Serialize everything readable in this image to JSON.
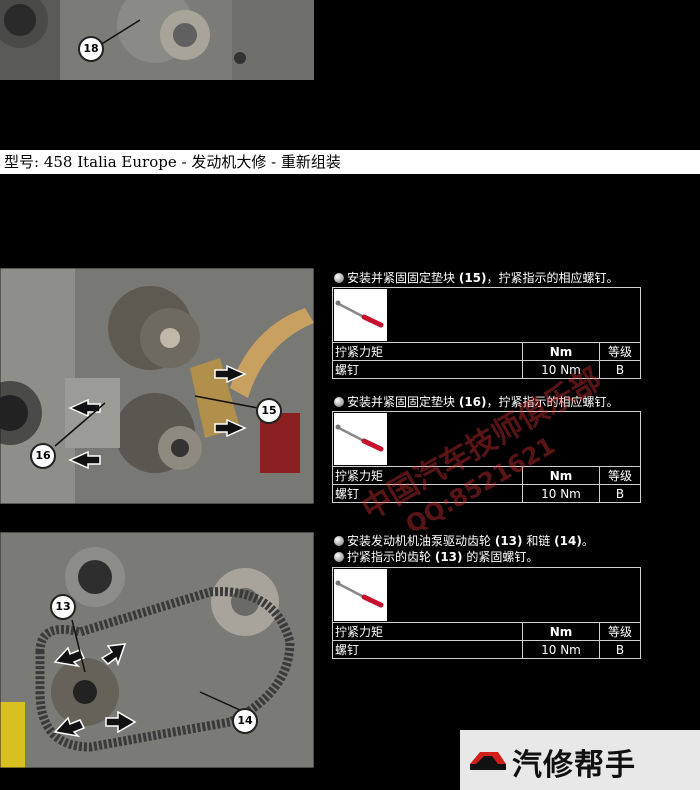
{
  "header": {
    "title": "型号: 458 Italia Europe - 发动机大修  - 重新组装"
  },
  "photos": {
    "top": {
      "callouts": [
        "18"
      ]
    },
    "mid": {
      "callouts": [
        "15",
        "16"
      ]
    },
    "bot": {
      "callouts": [
        "13",
        "14"
      ]
    }
  },
  "sections": [
    {
      "steps": [
        {
          "pre": "安装并紧固固定垫块 ",
          "ref": "(15)",
          "post": "，拧紧指示的相应螺钉。"
        }
      ],
      "torque": {
        "headers": [
          "拧紧力矩",
          "Nm",
          "等级"
        ],
        "rows": [
          [
            "螺钉",
            "10 Nm",
            "B"
          ]
        ]
      }
    },
    {
      "steps": [
        {
          "pre": "安装并紧固固定垫块 ",
          "ref": "(16)",
          "post": "，拧紧指示的相应螺钉。"
        }
      ],
      "torque": {
        "headers": [
          "拧紧力矩",
          "Nm",
          "等级"
        ],
        "rows": [
          [
            "螺钉",
            "10 Nm",
            "B"
          ]
        ]
      }
    },
    {
      "steps": [
        {
          "pre": "安装发动机机油泵驱动齿轮 ",
          "ref": "(13)",
          "mid": " 和链 ",
          "ref2": "(14)",
          "post": "。"
        },
        {
          "pre": "拧紧指示的齿轮 ",
          "ref": "(13)",
          "post": " 的紧固螺钉。"
        }
      ],
      "torque": {
        "headers": [
          "拧紧力矩",
          "Nm",
          "等级"
        ],
        "rows": [
          [
            "螺钉",
            "10 Nm",
            "B"
          ]
        ]
      }
    }
  ],
  "watermark": {
    "line1": "中国汽车技师俱乐部",
    "line2": "QQ:8521621"
  },
  "brand": {
    "name": "汽修帮手",
    "icon": "car-logo-icon",
    "color": "#d0201a"
  }
}
